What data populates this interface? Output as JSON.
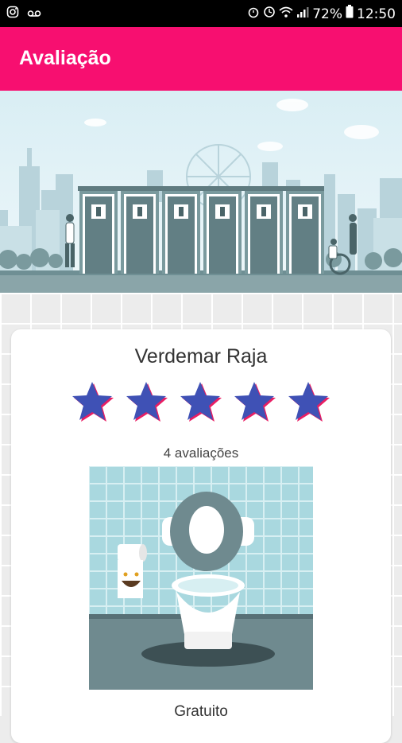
{
  "status_bar": {
    "left_icons": [
      "instagram-icon",
      "voicemail-icon"
    ],
    "battery_percent": "72%",
    "time": "12:50"
  },
  "app_bar": {
    "title": "Avaliação"
  },
  "card": {
    "place_name": "Verdemar Raja",
    "rating": 5,
    "rating_max": 5,
    "review_count": "4 avaliações",
    "price": "Gratuito"
  },
  "colors": {
    "accent": "#f70f70",
    "star": "#3f51b5",
    "star_shadow": "#e91e63"
  }
}
